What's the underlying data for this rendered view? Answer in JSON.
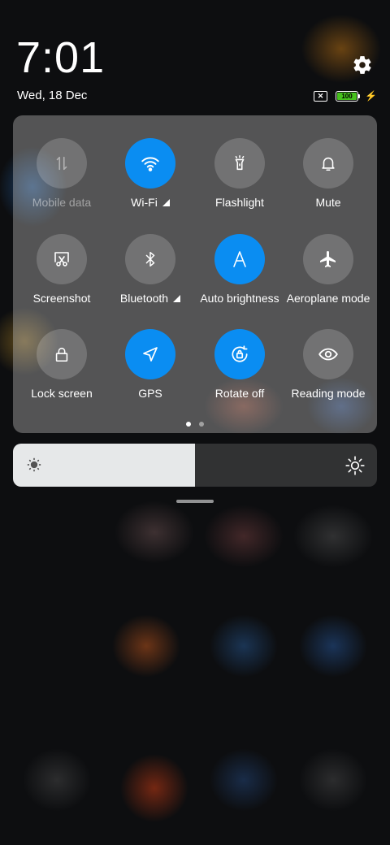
{
  "status": {
    "time": "7:01",
    "date": "Wed, 18 Dec",
    "battery_level": "100"
  },
  "tiles": [
    {
      "label": "Mobile data",
      "icon": "mobile-data-icon",
      "state": "disabled"
    },
    {
      "label": "Wi-Fi",
      "icon": "wifi-icon",
      "state": "on"
    },
    {
      "label": "Flashlight",
      "icon": "flashlight-icon",
      "state": "off"
    },
    {
      "label": "Mute",
      "icon": "bell-icon",
      "state": "off"
    },
    {
      "label": "Screenshot",
      "icon": "screenshot-icon",
      "state": "off"
    },
    {
      "label": "Bluetooth",
      "icon": "bluetooth-icon",
      "state": "off"
    },
    {
      "label": "Auto brightness",
      "icon": "auto-brightness-icon",
      "state": "on"
    },
    {
      "label": "Aeroplane mode",
      "icon": "airplane-icon",
      "state": "off"
    },
    {
      "label": "Lock screen",
      "icon": "lock-icon",
      "state": "off"
    },
    {
      "label": "GPS",
      "icon": "gps-icon",
      "state": "on"
    },
    {
      "label": "Rotate off",
      "icon": "rotate-lock-icon",
      "state": "on"
    },
    {
      "label": "Reading mode",
      "icon": "eye-icon",
      "state": "off"
    }
  ],
  "pager": {
    "pages": 2,
    "current": 1
  },
  "brightness": {
    "level": 0.5
  },
  "colors": {
    "accent": "#0a8df2",
    "battery": "#46c11d"
  }
}
